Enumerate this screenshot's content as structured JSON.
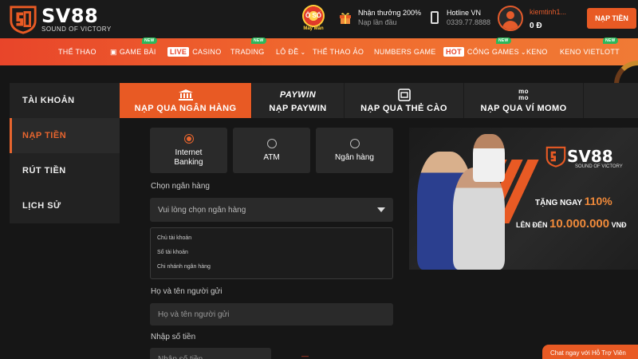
{
  "header": {
    "logo_name": "SV88",
    "logo_slogan": "SOUND OF VICTORY",
    "spin_label": "May Mắn",
    "spin_text": "Ô SỐ",
    "promo_title": "Nhận thưởng 200%",
    "promo_sub": "Nạp lần đầu",
    "hotline_title": "Hotline VN",
    "hotline_number": "0339.77.8888",
    "username": "kiemtinh1...",
    "balance": "0 Đ",
    "deposit_button": "NẠP TIỀN"
  },
  "nav": {
    "items": [
      {
        "label": "THỂ THAO"
      },
      {
        "label": "GAME BÀI",
        "badge": "NEW"
      },
      {
        "tag": "LIVE",
        "label": "CASINO"
      },
      {
        "label": "TRADING",
        "badge": "NEW"
      },
      {
        "label": "LÔ ĐỀ"
      },
      {
        "label": "THỂ THAO ẢO"
      },
      {
        "label": "NUMBERS GAME"
      },
      {
        "tag": "HOT",
        "label": "CỔNG GAMES",
        "badge": "NEW"
      },
      {
        "label": "KENO"
      },
      {
        "label": "KENO VIETLOTT",
        "badge": "NEW"
      }
    ]
  },
  "sidebar": {
    "items": [
      {
        "label": "TÀI KHOẢN"
      },
      {
        "label": "NẠP TIỀN",
        "active": true
      },
      {
        "label": "RÚT TIỀN"
      },
      {
        "label": "LỊCH SỬ"
      }
    ]
  },
  "tabs": [
    {
      "label": "NẠP QUA NGÂN HÀNG",
      "icon": "bank-icon",
      "active": true
    },
    {
      "label": "NẠP PAYWIN",
      "icon": "paywin-logo",
      "icon_text": "PAYWIN"
    },
    {
      "label": "NẠP QUA THẺ CÀO",
      "icon": "card-icon"
    },
    {
      "label": "NẠP QUA VÍ MOMO",
      "icon": "momo-logo",
      "icon_text": "mo mo"
    }
  ],
  "form": {
    "methods": [
      {
        "label": "Internet Banking",
        "checked": true
      },
      {
        "label": "ATM",
        "checked": false
      },
      {
        "label": "Ngân hàng",
        "checked": false
      }
    ],
    "bank_label": "Chọn ngân hàng",
    "bank_placeholder": "Vui lòng chọn ngân hàng",
    "details": [
      "Chủ tài khoản",
      "Số tài khoản",
      "Chi nhánh ngân hàng"
    ],
    "sender_label": "Họ và tên người gửi",
    "sender_placeholder": "Họ và tên người gửi",
    "amount_label": "Nhập số tiền",
    "amount_placeholder": "Nhập số tiền"
  },
  "banner": {
    "logo": "SV88",
    "slogan": "SOUND OF VICTORY",
    "line1_prefix": "TẶNG NGAY",
    "line1_value": "110%",
    "line2_prefix": "LÊN ĐẾN",
    "line2_value": "10.000.000",
    "line2_suffix": "VNĐ"
  },
  "chat": {
    "label": "Chat ngay với Hỗ Trợ Viên"
  },
  "colors": {
    "accent": "#e85a24",
    "background": "#161616",
    "panel": "#2a2a2a"
  }
}
